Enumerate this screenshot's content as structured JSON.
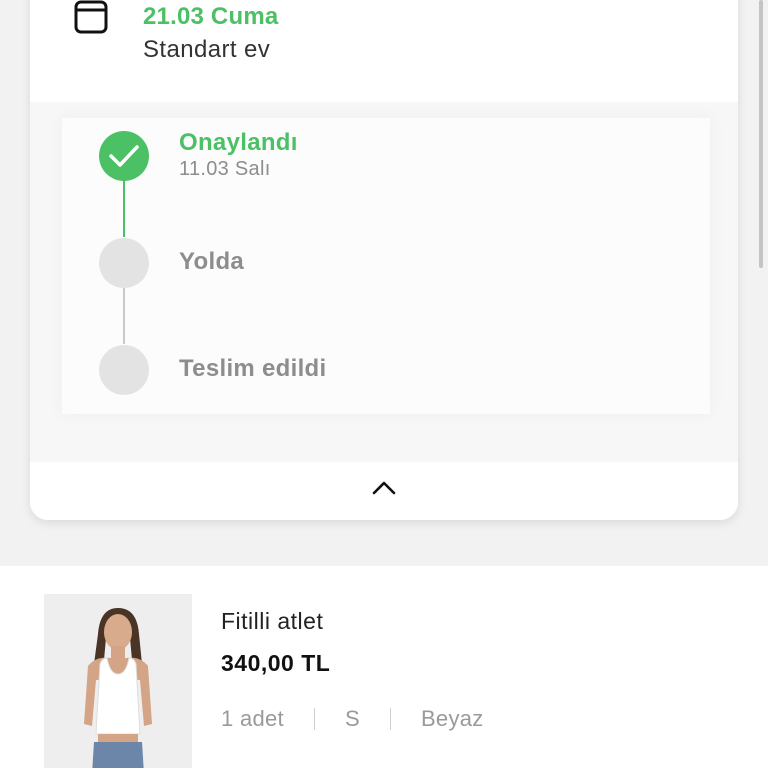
{
  "delivery": {
    "date": "21.03 Cuma",
    "type": "Standart ev",
    "icon": "calendar-icon"
  },
  "tracking": {
    "steps": [
      {
        "label": "Onaylandı",
        "date": "11.03 Salı",
        "status": "done"
      },
      {
        "label": "Yolda",
        "status": "pending"
      },
      {
        "label": "Teslim edildi",
        "status": "pending"
      }
    ],
    "collapse_icon": "chevron-up-icon"
  },
  "product": {
    "name": "Fitilli atlet",
    "price": "340,00 TL",
    "quantity": "1 adet",
    "size": "S",
    "color": "Beyaz"
  },
  "colors": {
    "accent_green": "#4cc065",
    "pending_grey": "#e3e3e3",
    "text_muted": "#8d8d8d"
  }
}
